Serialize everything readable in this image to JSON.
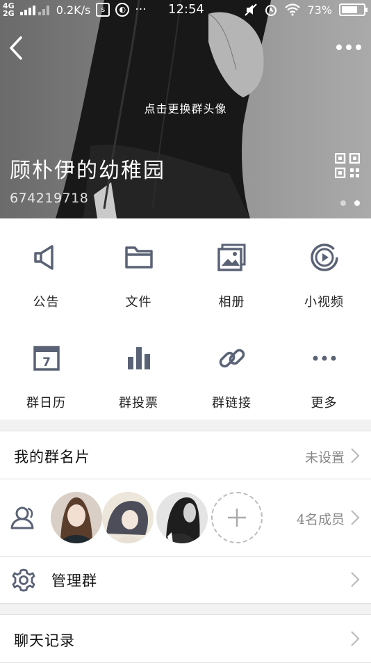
{
  "status_bar": {
    "network_top": "4G",
    "network_bottom": "2G",
    "speed": "0.2K/s",
    "time": "12:54",
    "battery": "73%",
    "battery_level": 0.73,
    "more": "···"
  },
  "header": {
    "change_avatar_hint": "点击更换群头像",
    "group_name": "顾朴伊的幼稚园",
    "group_id": "674219718",
    "page_count": 2,
    "active_page": 1
  },
  "grid": {
    "items": [
      {
        "label": "公告",
        "icon": "megaphone-icon"
      },
      {
        "label": "文件",
        "icon": "folder-icon"
      },
      {
        "label": "相册",
        "icon": "photo-album-icon"
      },
      {
        "label": "小视频",
        "icon": "video-icon"
      },
      {
        "label": "群日历",
        "icon": "calendar-icon",
        "calendar_day": "7"
      },
      {
        "label": "群投票",
        "icon": "bar-chart-icon"
      },
      {
        "label": "群链接",
        "icon": "link-icon"
      },
      {
        "label": "更多",
        "icon": "more-icon"
      }
    ]
  },
  "card_row": {
    "title": "我的群名片",
    "value": "未设置"
  },
  "members_row": {
    "count_label": "4名成员"
  },
  "manage_row": {
    "title": "管理群"
  },
  "history_row": {
    "title": "聊天记录"
  },
  "colors": {
    "icon_gray": "#5a6275",
    "text_primary": "#222222",
    "text_secondary": "#888888",
    "divider": "#e0e0e0",
    "background": "#f2f2f2"
  }
}
